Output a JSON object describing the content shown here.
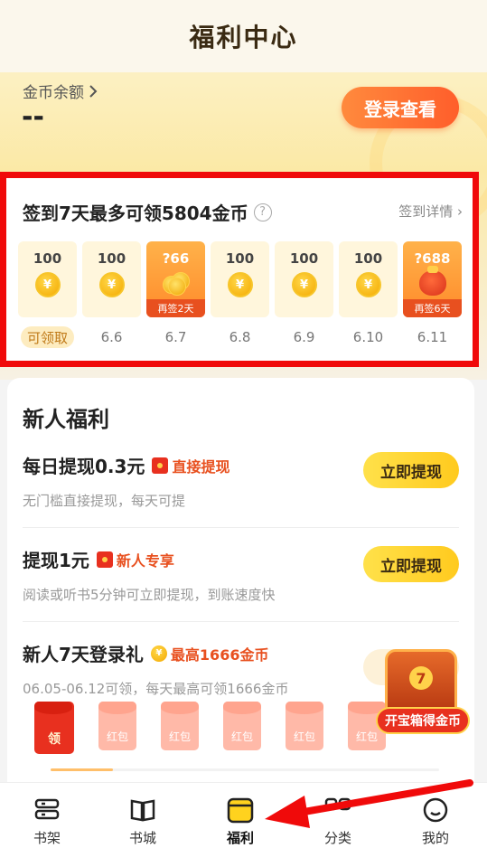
{
  "header": {
    "title": "福利中心"
  },
  "balance": {
    "label": "金币余额",
    "value": "--",
    "login_button": "登录查看"
  },
  "signin": {
    "title": "签到7天最多可领5804金币",
    "detail_link": "签到详情",
    "days": [
      {
        "amount": "100",
        "label": "可领取",
        "tag": "",
        "kind": "coin",
        "claimable": true
      },
      {
        "amount": "100",
        "label": "6.6",
        "tag": "",
        "kind": "coin",
        "claimable": false
      },
      {
        "amount": "?66",
        "label": "6.7",
        "tag": "再签2天",
        "kind": "stack",
        "claimable": false
      },
      {
        "amount": "100",
        "label": "6.8",
        "tag": "",
        "kind": "coin",
        "claimable": false
      },
      {
        "amount": "100",
        "label": "6.9",
        "tag": "",
        "kind": "coin",
        "claimable": false
      },
      {
        "amount": "100",
        "label": "6.10",
        "tag": "",
        "kind": "coin",
        "claimable": false
      },
      {
        "amount": "?688",
        "label": "6.11",
        "tag": "再签6天",
        "kind": "bag",
        "claimable": false
      }
    ]
  },
  "newbie": {
    "title": "新人福利",
    "tasks": [
      {
        "title": "每日提现0.3元",
        "badge": "直接提现",
        "desc": "无门槛直接提现，每天可提",
        "button": "立即提现"
      },
      {
        "title": "提现1元",
        "badge": "新人专享",
        "desc": "阅读或听书5分钟可立即提现，到账速度快",
        "button": "立即提现"
      },
      {
        "title": "新人7天登录礼",
        "badge": "最高1666金币",
        "desc": "06.05-06.12可领，每天最高可领1666金币",
        "button": "领红包"
      }
    ],
    "envelopes": {
      "first_label": "领",
      "other_label": "红包"
    },
    "progress": 0.16
  },
  "chest": {
    "label": "开宝箱得金币"
  },
  "tabbar": {
    "items": [
      {
        "label": "书架",
        "icon": "bookshelf-icon"
      },
      {
        "label": "书城",
        "icon": "book-icon"
      },
      {
        "label": "福利",
        "icon": "welfare-icon",
        "active": true
      },
      {
        "label": "分类",
        "icon": "category-icon"
      },
      {
        "label": "我的",
        "icon": "profile-icon"
      }
    ]
  },
  "colors": {
    "accent": "#ff6a2b",
    "button_yellow": "#ffd21e",
    "highlight": "#f00a0a"
  }
}
